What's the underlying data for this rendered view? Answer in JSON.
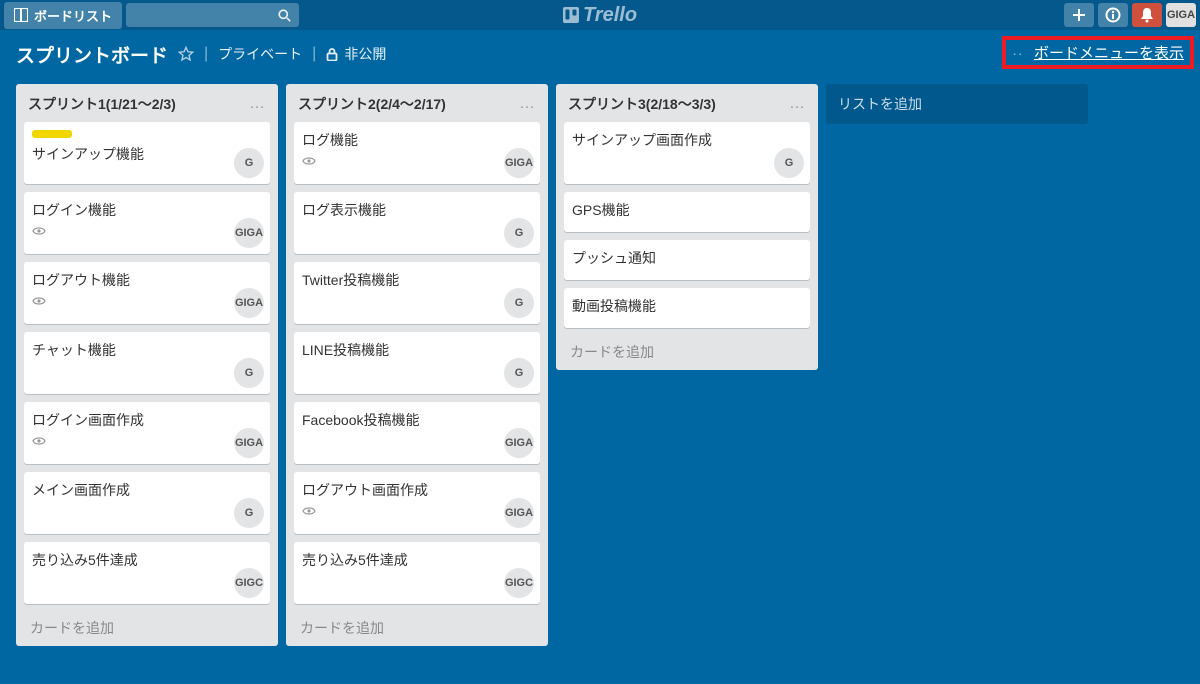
{
  "header": {
    "boards_button": "ボードリスト",
    "logo_text": "Trello",
    "avatar": "GIGA"
  },
  "boardbar": {
    "name": "スプリントボード",
    "private": "プライベート",
    "locked": "非公開",
    "show_menu": "ボードメニューを表示"
  },
  "lists": [
    {
      "title": "スプリント1(1/21～2/3)",
      "cards": [
        {
          "title": "サインアップ機能",
          "label": true,
          "eye": false,
          "member": "G"
        },
        {
          "title": "ログイン機能",
          "eye": true,
          "member": "GIGA"
        },
        {
          "title": "ログアウト機能",
          "eye": true,
          "member": "GIGA"
        },
        {
          "title": "チャット機能",
          "member": "G"
        },
        {
          "title": "ログイン画面作成",
          "eye": true,
          "member": "GIGA"
        },
        {
          "title": "メイン画面作成",
          "member": "G"
        },
        {
          "title": "売り込み5件達成",
          "member": "GIGC"
        }
      ],
      "add": "カードを追加"
    },
    {
      "title": "スプリント2(2/4～2/17)",
      "cards": [
        {
          "title": "ログ機能",
          "eye": true,
          "member": "GIGA"
        },
        {
          "title": "ログ表示機能",
          "member": "G"
        },
        {
          "title": "Twitter投稿機能",
          "member": "G"
        },
        {
          "title": "LINE投稿機能",
          "member": "G"
        },
        {
          "title": "Facebook投稿機能",
          "member": "GIGA"
        },
        {
          "title": "ログアウト画面作成",
          "eye": true,
          "member": "GIGA"
        },
        {
          "title": "売り込み5件達成",
          "member": "GIGC"
        }
      ],
      "add": "カードを追加"
    },
    {
      "title": "スプリント3(2/18～3/3)",
      "cards": [
        {
          "title": "サインアップ画面作成",
          "member": "G"
        },
        {
          "title": "GPS機能"
        },
        {
          "title": "プッシュ通知"
        },
        {
          "title": "動画投稿機能"
        }
      ],
      "add": "カードを追加"
    }
  ],
  "add_list": "リストを追加"
}
